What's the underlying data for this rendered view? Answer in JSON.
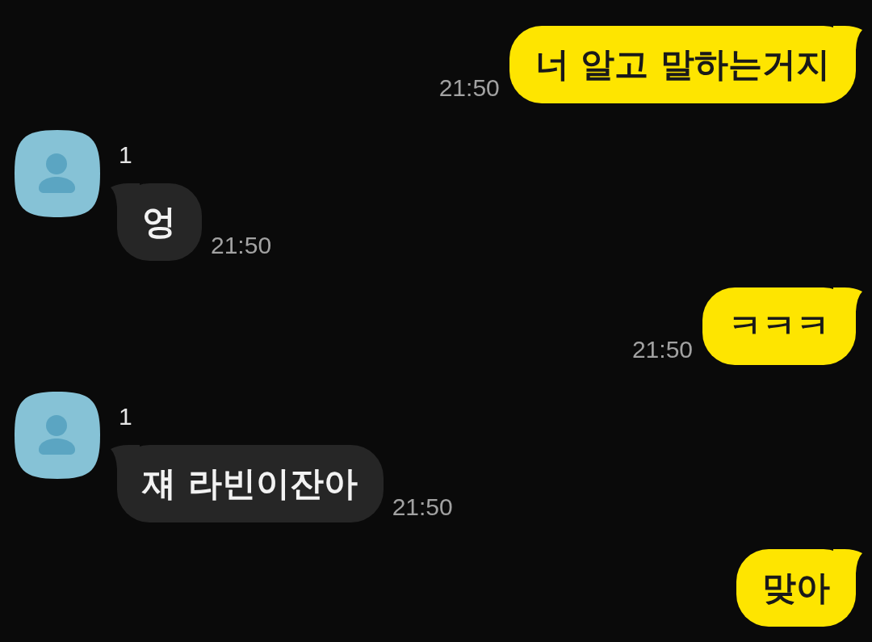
{
  "messages": [
    {
      "kind": "sent",
      "text": "너 알고 말하는거지",
      "time": "21:50"
    },
    {
      "kind": "received",
      "sender": "1",
      "text": "엉",
      "time": "21:50"
    },
    {
      "kind": "sent",
      "text": "ㅋㅋㅋ",
      "time": "21:50"
    },
    {
      "kind": "received",
      "sender": "1",
      "text": "쟤 라빈이잔아",
      "time": "21:50"
    },
    {
      "kind": "sent",
      "text": "맞아"
    }
  ]
}
